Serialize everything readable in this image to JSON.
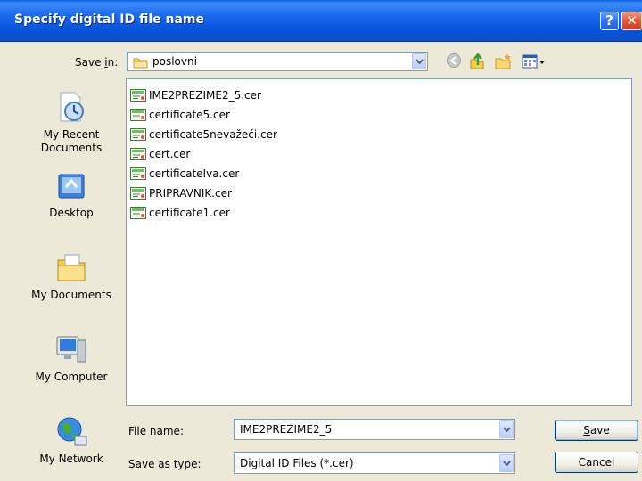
{
  "window": {
    "title": "Specify digital ID file name"
  },
  "toolbar": {
    "save_in_label": "Save in:",
    "save_in_value": "poslovni",
    "icons": [
      "back-icon",
      "up-folder-icon",
      "new-folder-icon",
      "view-menu-icon"
    ]
  },
  "places": [
    {
      "label": "My Recent Documents",
      "line1": "My Recent",
      "line2": "Documents",
      "icon": "recent-documents-icon"
    },
    {
      "label": "Desktop",
      "icon": "desktop-icon"
    },
    {
      "label": "My Documents",
      "icon": "my-documents-icon"
    },
    {
      "label": "My Computer",
      "icon": "my-computer-icon"
    },
    {
      "label": "My Network",
      "icon": "my-network-icon"
    }
  ],
  "files": [
    "IME2PREZIME2_5.cer",
    "certificate5.cer",
    "certificate5nevažeći.cer",
    "cert.cer",
    "certificateIva.cer",
    "PRIPRAVNIK.cer",
    "certificate1.cer"
  ],
  "form": {
    "file_name_label": "File name:",
    "file_name_value": "IME2PREZIME2_5",
    "save_as_type_label": "Save as type:",
    "save_as_type_value": "Digital ID Files (*.cer)"
  },
  "buttons": {
    "save": "Save",
    "cancel": "Cancel"
  },
  "colors": {
    "title_bar": "#0a54dc",
    "dialog_bg": "#ece9d8",
    "close_button": "#e0532e"
  }
}
